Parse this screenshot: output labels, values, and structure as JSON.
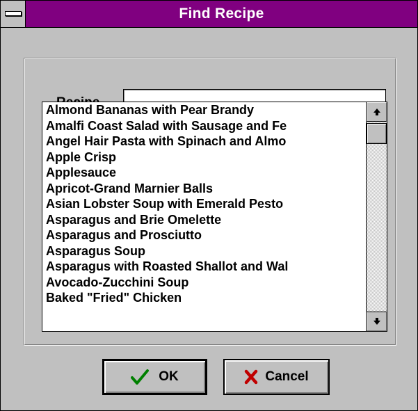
{
  "window": {
    "title": "Find Recipe",
    "title_bar_color": "#800080",
    "face_color": "#c0c0c0",
    "system_menu_icon": "system-menu-icon"
  },
  "form": {
    "recipe_label": "Recipe",
    "recipe_value": "",
    "recipe_placeholder": ""
  },
  "recipe_list": {
    "items": [
      "Almond Bananas with Pear Brandy",
      "Amalfi Coast Salad with Sausage and Fe",
      "Angel Hair Pasta with Spinach and Almo",
      "Apple Crisp",
      "Applesauce",
      "Apricot-Grand Marnier Balls",
      "Asian Lobster Soup with Emerald Pesto",
      "Asparagus and Brie Omelette",
      "Asparagus and Prosciutto",
      "Asparagus Soup",
      "Asparagus with Roasted Shallot and Wal",
      "Avocado-Zucchini Soup",
      "Baked \"Fried\" Chicken"
    ],
    "scroll_up_icon": "arrow-up-icon",
    "scroll_down_icon": "arrow-down-icon"
  },
  "buttons": {
    "ok_label": "OK",
    "ok_icon": "checkmark-icon",
    "ok_icon_color": "#008000",
    "cancel_label": "Cancel",
    "cancel_icon": "x-icon",
    "cancel_icon_color": "#c00000"
  }
}
